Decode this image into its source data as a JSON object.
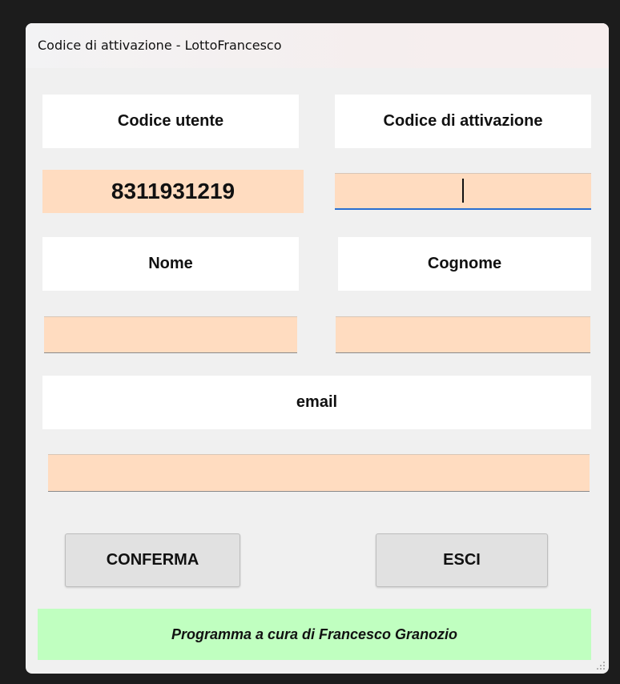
{
  "window": {
    "title": "Codice di attivazione - LottoFrancesco"
  },
  "labels": {
    "codice_utente": "Codice utente",
    "codice_attivazione": "Codice di attivazione",
    "nome": "Nome",
    "cognome": "Cognome",
    "email": "email"
  },
  "values": {
    "codice_utente": "8311931219",
    "codice_attivazione": "",
    "nome": "",
    "cognome": "",
    "email": ""
  },
  "buttons": {
    "confirm": "CONFERMA",
    "exit": "ESCI"
  },
  "footer": {
    "credit": "Programma a cura di Francesco Granozio"
  },
  "colors": {
    "field_background": "#ffdcc0",
    "footer_background": "#c0ffc0",
    "focus_underline": "#2a6fd0"
  },
  "icons": {
    "resize_grip": "resize-grip-icon"
  }
}
